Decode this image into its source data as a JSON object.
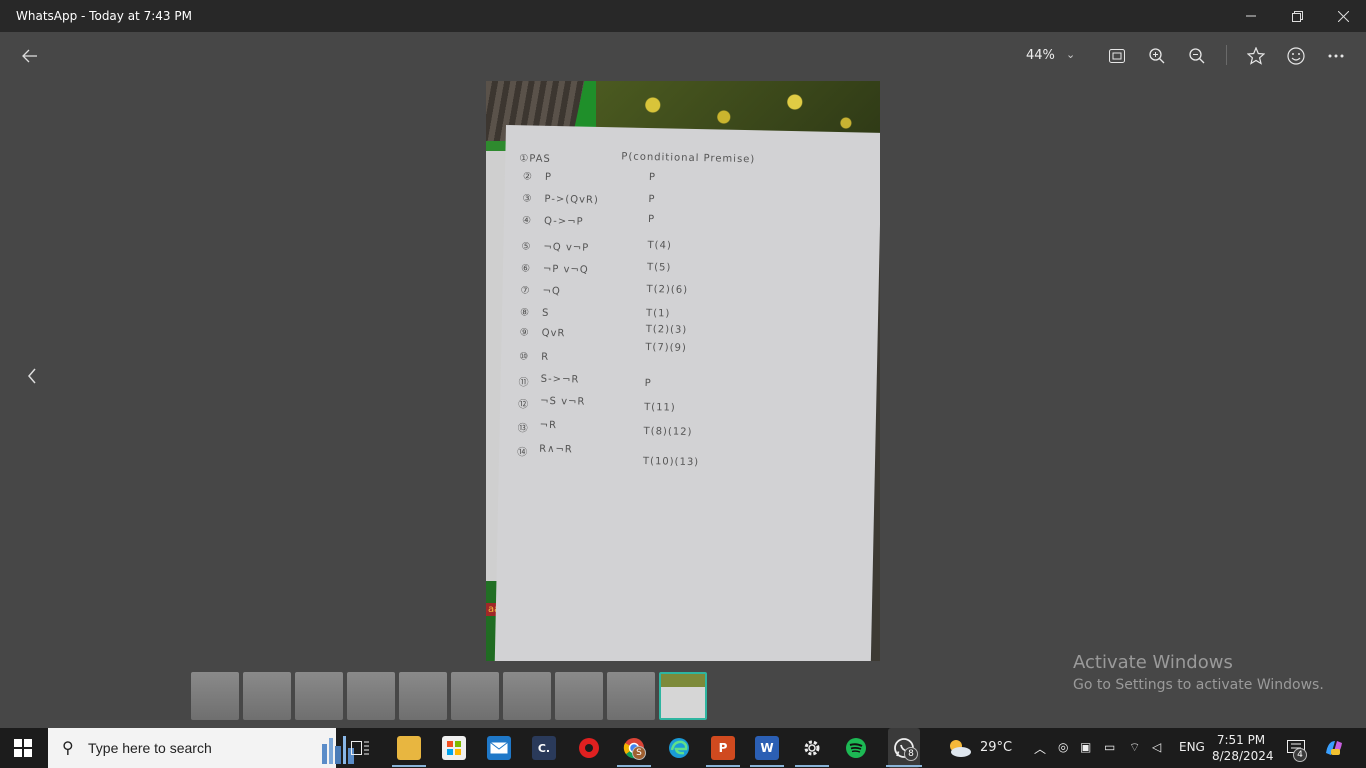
{
  "window": {
    "title": "WhatsApp - Today at 7:43 PM",
    "minimize_icon": "minimize-icon",
    "restore_icon": "restore-icon",
    "close_icon": "close-icon"
  },
  "toolbar": {
    "zoom_value": "44%",
    "icons": [
      "back-arrow-icon",
      "chevron-down-icon",
      "fit-screen-icon",
      "zoom-in-icon",
      "zoom-out-icon",
      "favorite-star-icon",
      "emoji-icon",
      "more-icon"
    ]
  },
  "photo": {
    "header_left": "①PAS",
    "header_right": "P(conditional Premise)",
    "rows": [
      {
        "num": "②",
        "stmt": "P",
        "reason": "P"
      },
      {
        "num": "③",
        "stmt": "P->(QvR)",
        "reason": "P"
      },
      {
        "num": "④",
        "stmt": "Q->¬P",
        "reason": "P"
      },
      {
        "num": "⑤",
        "stmt": "¬Q v¬P",
        "reason": "T(4)"
      },
      {
        "num": "⑥",
        "stmt": "¬P v¬Q",
        "reason": "T(5)"
      },
      {
        "num": "⑦",
        "stmt": "¬Q",
        "reason": "T(2)(6)"
      },
      {
        "num": "⑧",
        "stmt": "S",
        "reason": "T(1)"
      },
      {
        "num": "⑨",
        "stmt": "QvR",
        "reason": "T(2)(3)"
      },
      {
        "num": "⑩",
        "stmt": "R",
        "reason": "T(7)(9)"
      },
      {
        "num": "⑪",
        "stmt": "S->¬R",
        "reason": "P"
      },
      {
        "num": "⑫",
        "stmt": "¬S v¬R",
        "reason": "T(11)"
      },
      {
        "num": "⑬",
        "stmt": "¬R",
        "reason": "T(8)(12)"
      },
      {
        "num": "⑭",
        "stmt": "R∧¬R",
        "reason": "T(10)(13)"
      }
    ],
    "corner_text": "aat"
  },
  "thumbnails": {
    "count": 10,
    "active_index": 9
  },
  "watermark": {
    "line1": "Activate Windows",
    "line2": "Go to Settings to activate Windows."
  },
  "taskbar": {
    "search_placeholder": "Type here to search",
    "chrome_badge": "S",
    "whatsapp_badge": "8",
    "weather": "29°C",
    "language": "ENG",
    "time": "7:51 PM",
    "date": "8/28/2024",
    "notification_count": "4"
  },
  "colors": {
    "background": "#474747",
    "titlebar": "#282828",
    "taskbar": "#1c1c1c",
    "active_thumb_border": "#2eb5a0"
  }
}
